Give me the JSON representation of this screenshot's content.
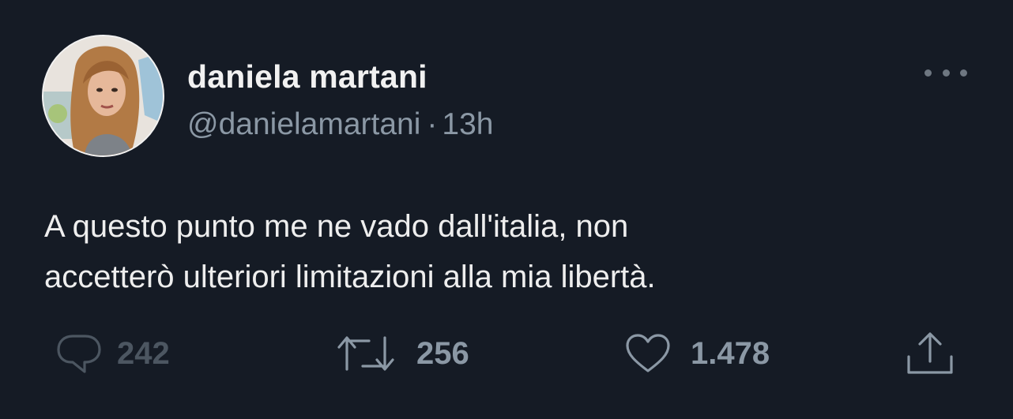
{
  "author": {
    "name": "daniela martani",
    "handle": "@danielamartani",
    "separator": "·",
    "time": "13h"
  },
  "tweet": {
    "lines": [
      "A questo punto me ne vado dall'italia, non",
      "accetterò ulteriori limitazioni alla mia libertà."
    ]
  },
  "actions": {
    "replies": "242",
    "retweets": "256",
    "likes": "1.478"
  },
  "icons": {
    "more": "more-horizontal-icon",
    "reply": "reply-icon",
    "retweet": "retweet-icon",
    "like": "heart-icon",
    "share": "share-icon"
  },
  "colors": {
    "background": "#151b25",
    "text": "#e7e9ea",
    "secondary": "#8b98a5"
  }
}
